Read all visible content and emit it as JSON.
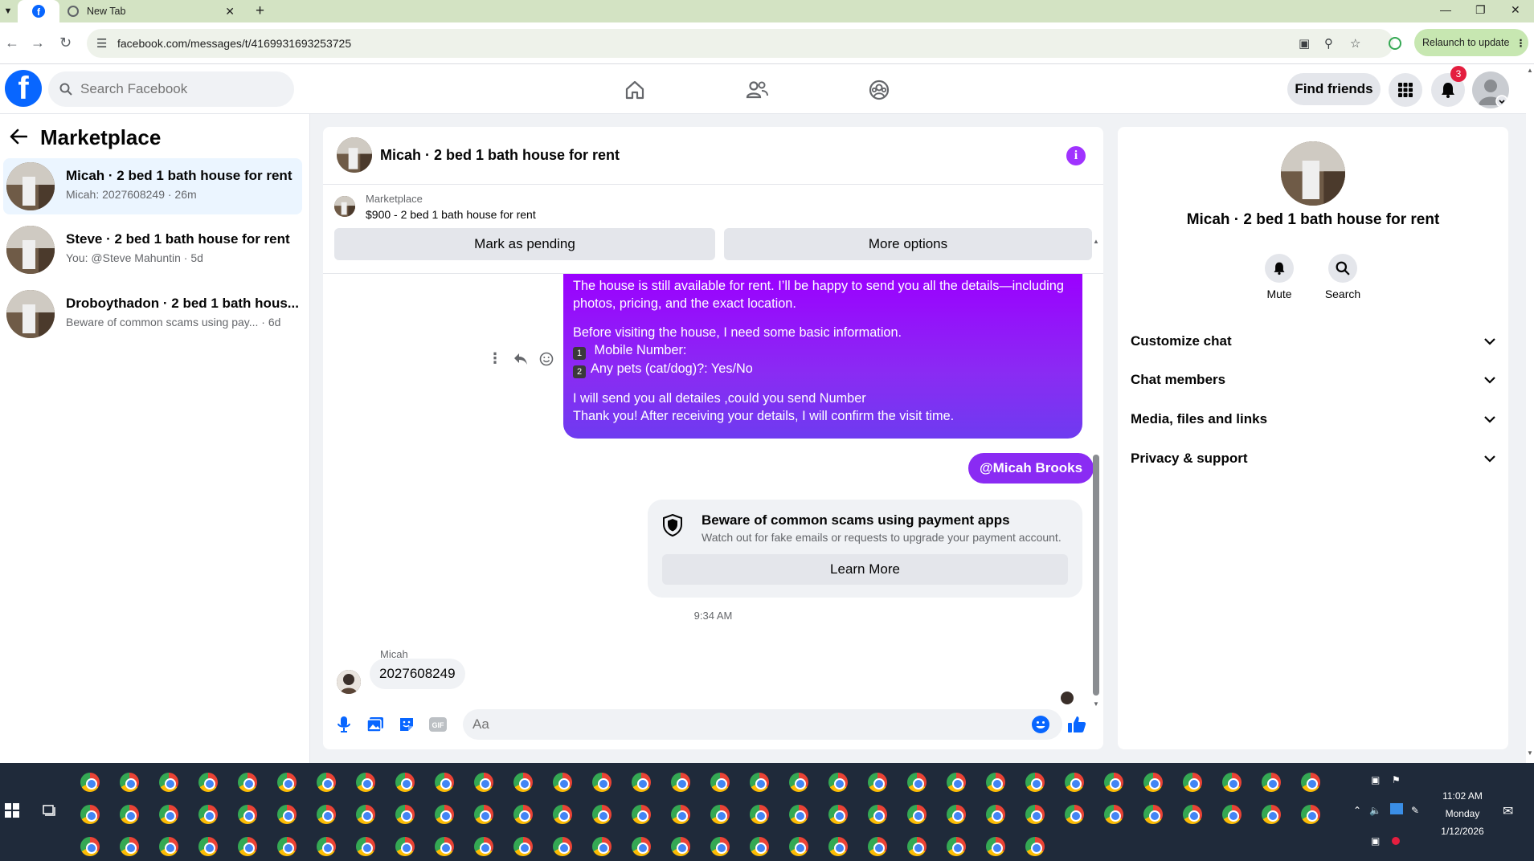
{
  "browser": {
    "tab_active_icon": "facebook-icon",
    "tab_new_label": "New Tab",
    "url": "facebook.com/messages/t/4169931693253725",
    "relaunch_label": "Relaunch to update"
  },
  "fb_header": {
    "search_placeholder": "Search Facebook",
    "find_friends": "Find friends",
    "notifications_count": "3"
  },
  "sidebar": {
    "title": "Marketplace",
    "conversations": [
      {
        "title": "Micah · 2 bed 1 bath house for rent",
        "subtitle": "Micah: 2027608249 · 26m",
        "selected": true
      },
      {
        "title": "Steve · 2 bed 1 bath house for rent",
        "subtitle": "You: @Steve Mahuntin · 5d",
        "selected": false
      },
      {
        "title": "Droboythadon · 2 bed 1 bath hous...",
        "subtitle": "Beware of common scams using pay...  · 6d",
        "selected": false
      }
    ]
  },
  "chat": {
    "title": "Micah · 2 bed 1 bath house for rent",
    "marketplace_label": "Marketplace",
    "listing": "$900 - 2 bed 1 bath house for rent",
    "mark_pending": "Mark as pending",
    "more_options": "More options",
    "outgoing": {
      "line1": "The house is still available for rent. I’ll be happy to send you all the details—including",
      "line2": "photos, pricing, and the exact location.",
      "line3": "Before visiting the house, I need some basic information.",
      "item1_num": "1",
      "item1": "Mobile Number:",
      "item2_num": "2",
      "item2": "Any pets (cat/dog)?: Yes/No",
      "line4": "I will send you all detailes ,could you send Number",
      "line5": "Thank you! After receiving your details, I will confirm the visit time."
    },
    "mention": "@Micah Brooks",
    "scam_notice": {
      "title": "Beware of common scams using payment apps",
      "description": "Watch out for fake emails or requests to upgrade your payment account.",
      "button": "Learn More"
    },
    "timestamp": "9:34 AM",
    "incoming": {
      "sender": "Micah",
      "text": "2027608249"
    },
    "composer_placeholder": "Aa"
  },
  "info_panel": {
    "name": "Micah · 2 bed 1 bath house for rent",
    "actions": [
      {
        "label": "Mute",
        "icon": "bell-icon"
      },
      {
        "label": "Search",
        "icon": "search-icon"
      }
    ],
    "sections": [
      {
        "label": "Customize chat"
      },
      {
        "label": "Chat members"
      },
      {
        "label": "Media, files and links"
      },
      {
        "label": "Privacy & support"
      }
    ]
  },
  "taskbar": {
    "time": "11:02 AM",
    "day": "Monday",
    "date": "1/12/2026"
  },
  "colors": {
    "fb_blue": "#0866ff",
    "messenger_purple": "#8a2bf3",
    "selected_conv": "#ebf5ff",
    "tabstrip": "#d3e3c3"
  }
}
